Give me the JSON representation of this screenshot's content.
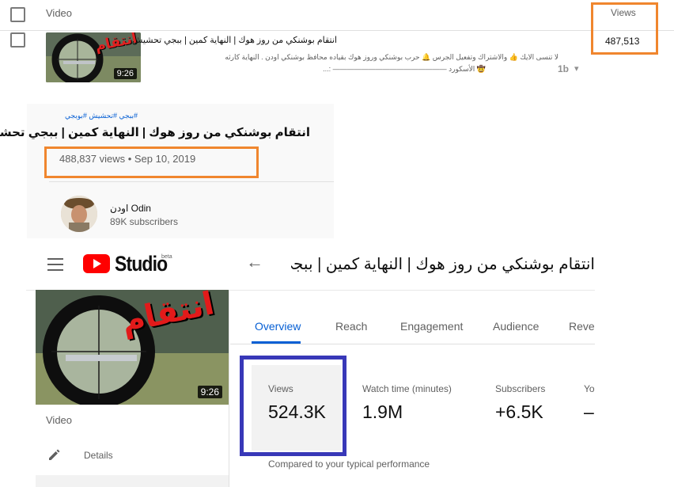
{
  "video_list": {
    "header": {
      "video_label": "Video",
      "views_label": "Views"
    },
    "row": {
      "duration": "9:26",
      "thumbnail_overlay_text": "انتقام",
      "title": "انتقام بوشنكي من روز هوك | النهاية كمين | ببجي تحشيش",
      "description_line1": "لا تنسى الايك 👍 والاشتراك وتفعيل الجرس 🔔 حرب بوشنكي وروز هوك بقياده محافظ بوشنكي اودن . النهاية كارثه",
      "description_line2": "🤠 الأسكورد ———————————————— :...",
      "icon_text": "1b",
      "views": "487,513"
    }
  },
  "watch_page": {
    "tags": "#ببجي #تحشيش #بوبجي",
    "title": "انتقام بوشنكي من روز هوك | النهاية كمين | ببجي تحشيش",
    "meta": "488,837 views • Sep 10, 2019",
    "channel_name": "اودن Odin",
    "subscribers": "89K subscribers"
  },
  "studio": {
    "logo_text": "Studio",
    "logo_beta": "beta",
    "title": "انتقام بوشنكي من روز هوك | النهاية كمين | ببجي تحشيش",
    "thumbnail_overlay_text": "انتقام",
    "duration": "9:26",
    "sidebar": {
      "video_label": "Video",
      "details_label": "Details"
    },
    "tabs": [
      {
        "label": "Overview",
        "active": true
      },
      {
        "label": "Reach",
        "active": false
      },
      {
        "label": "Engagement",
        "active": false
      },
      {
        "label": "Audience",
        "active": false
      },
      {
        "label": "Reven",
        "active": false
      }
    ],
    "metrics": [
      {
        "label": "Views",
        "value": "524.3K"
      },
      {
        "label": "Watch time (minutes)",
        "value": "1.9M"
      },
      {
        "label": "Subscribers",
        "value": "+6.5K"
      },
      {
        "label": "Yo",
        "value": "–"
      }
    ],
    "compare_text": "Compared to your typical performance"
  },
  "colors": {
    "orange_highlight": "#f0862e",
    "blue_highlight": "#3838b8",
    "youtube_red": "#ff0000",
    "active_tab": "#065fd4"
  }
}
